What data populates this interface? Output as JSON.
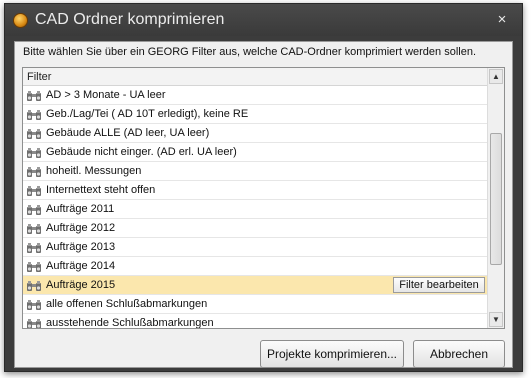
{
  "window": {
    "title": "CAD Ordner komprimieren",
    "close_symbol": "×",
    "icon": "app-coin-icon"
  },
  "instruction": "Bitte wählen Sie über ein GEORG Filter aus, welche CAD-Ordner komprimiert werden sollen.",
  "list": {
    "header": "Filter",
    "row_icon": "binoculars-icon",
    "selected_index": 10,
    "edit_button_label": "Filter bearbeiten",
    "items": [
      "AD > 3 Monate - UA leer",
      "Geb./Lag/Tei ( AD 10T erledigt), keine RE",
      "Gebäude  ALLE  (AD leer, UA leer)",
      "Gebäude nicht einger.  (AD erl.  UA leer)",
      "hoheitl. Messungen",
      "Internettext steht offen",
      "Aufträge 2011",
      "Aufträge 2012",
      "Aufträge 2013",
      "Aufträge 2014",
      "Aufträge 2015",
      "alle offenen Schlußabmarkungen",
      "ausstehende Schlußabmarkungen"
    ]
  },
  "scrollbar": {
    "up_symbol": "▲",
    "down_symbol": "▼"
  },
  "buttons": {
    "compress": "Projekte komprimieren...",
    "cancel": "Abbrechen"
  },
  "colors": {
    "selected_row": "#fbe7ad",
    "titlebar": "#3c3c3c"
  }
}
